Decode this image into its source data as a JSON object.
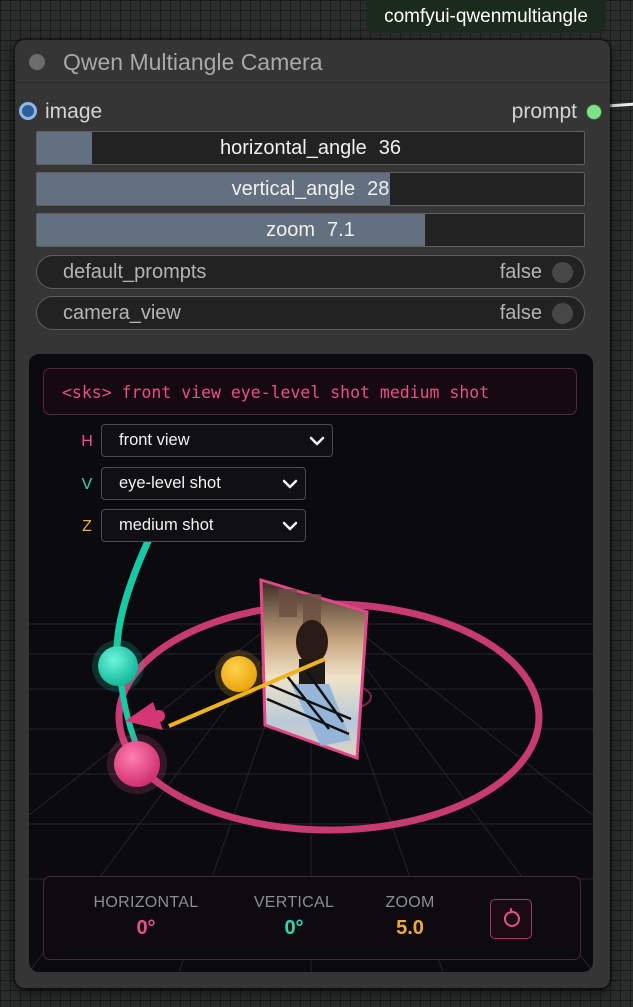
{
  "group_badge": "comfyui-qwenmultiangle",
  "node": {
    "title": "Qwen Multiangle Camera",
    "input_label": "image",
    "output_label": "prompt"
  },
  "sliders": [
    {
      "name": "horizontal_angle",
      "value": "36",
      "fill_fraction": 0.1
    },
    {
      "name": "vertical_angle",
      "value": "28",
      "fill_fraction": 0.645
    },
    {
      "name": "zoom",
      "value": "7.1",
      "fill_fraction": 0.71
    }
  ],
  "toggles": [
    {
      "name": "default_prompts",
      "value": "false"
    },
    {
      "name": "camera_view",
      "value": "false"
    }
  ],
  "viewport": {
    "prompt_text": "<sks> front view eye-level shot medium shot",
    "selectors": [
      {
        "letter": "H",
        "value": "front view",
        "color": "#e84f8c"
      },
      {
        "letter": "V",
        "value": "eye-level shot",
        "color": "#2fd6b4"
      },
      {
        "letter": "Z",
        "value": "medium shot",
        "color": "#f2a93b"
      }
    ],
    "info": {
      "horizontal_label": "HORIZONTAL",
      "horizontal_value": "0°",
      "vertical_label": "VERTICAL",
      "vertical_value": "0°",
      "zoom_label": "ZOOM",
      "zoom_value": "5.0"
    }
  },
  "colors": {
    "accent_pink": "#e84f8c",
    "accent_teal": "#2fd6b4",
    "accent_orange": "#f2a93b",
    "slider_fill": "#62707f",
    "output_slot": "#7de389",
    "input_slot": "#8db7ea"
  }
}
